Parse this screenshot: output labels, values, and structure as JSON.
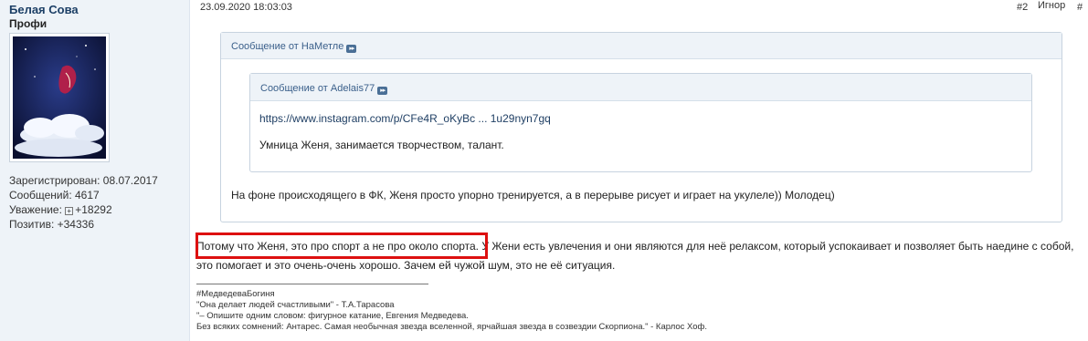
{
  "user": {
    "name": "Белая Сова",
    "title": "Профи",
    "registered": "Зарегистрирован: 08.07.2017",
    "posts": "Сообщений: 4617",
    "respect_label": "Уважение:",
    "respect_value": "+18292",
    "positive": "Позитив: +34336"
  },
  "post": {
    "date": "23.09.2020 18:03:03",
    "number": "#2",
    "ignore": "Игнор",
    "hash": "#"
  },
  "quote_outer": {
    "header": "Сообщение от НаМетле",
    "text": "На фоне происходящего в ФК, Женя просто упорно тренируется, а в перерыве рисует и играет на укулеле)) Молодец)"
  },
  "quote_inner": {
    "header": "Сообщение от Adelais77",
    "link": "https://www.instagram.com/p/CFe4R_oKyBc ... 1u29nyn7gq",
    "text": "Умница Женя, занимается творчеством, талант."
  },
  "message": {
    "highlighted": "Потому что Женя, это про спорт а не про около спорта.",
    "rest": "У Жени есть увлечения и они являются для неё релаксом, который успокаивает и позволяет быть наедине с собой, это помогает и это очень-очень хорошо. Зачем ей чужой шум, это не её ситуация."
  },
  "signature": {
    "line1": "#МедведеваБогиня",
    "line2": "\"Она делает людей счастливыми\" - Т.А.Тарасова",
    "line3": "\"– Опишите одним словом: фигурное катание, Евгения Медведева.",
    "line4": "Без всяких сомнений: Антарес. Самая необычная звезда вселенной, ярчайшая звезда в созвездии Скорпиона.\" - Карлос Хоф."
  },
  "colors": {
    "sidebar_bg": "#eef3f8",
    "username": "#1c3f66",
    "highlight_box": "#dd1010"
  }
}
